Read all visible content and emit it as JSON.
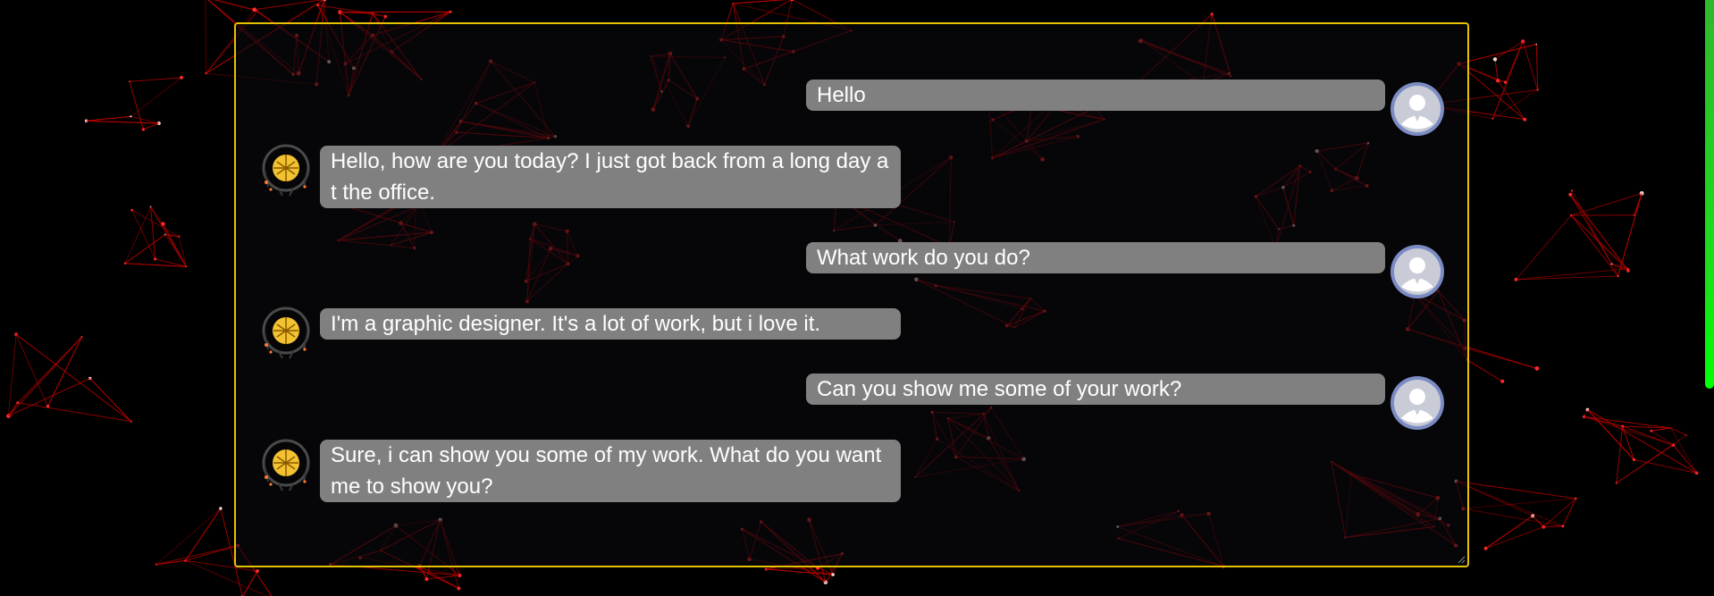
{
  "chat": {
    "messages": [
      {
        "role": "user",
        "text": "Hello",
        "avatar_icon": "user-avatar-icon"
      },
      {
        "role": "bot",
        "text": "Hello, how are you today? I just got back from a long day at the office.",
        "avatar_icon": "bot-avatar-icon"
      },
      {
        "role": "user",
        "text": "What work do you do?",
        "avatar_icon": "user-avatar-icon"
      },
      {
        "role": "bot",
        "text": "I'm a graphic designer. It's a lot of work, but i love it.",
        "avatar_icon": "bot-avatar-icon"
      },
      {
        "role": "user",
        "text": "Can you show me some of your work?",
        "avatar_icon": "user-avatar-icon"
      },
      {
        "role": "bot",
        "text": "Sure, i can show you some of my work. What do you want me to show you?",
        "avatar_icon": "bot-avatar-icon"
      }
    ]
  },
  "colors": {
    "background": "#000000",
    "chat_border": "#e6c200",
    "bubble": "#808080",
    "bubble_text": "#ffffff",
    "network_lines": "#c00000",
    "scroll_indicator": "#19e019",
    "user_avatar": "#7b8cc4"
  }
}
